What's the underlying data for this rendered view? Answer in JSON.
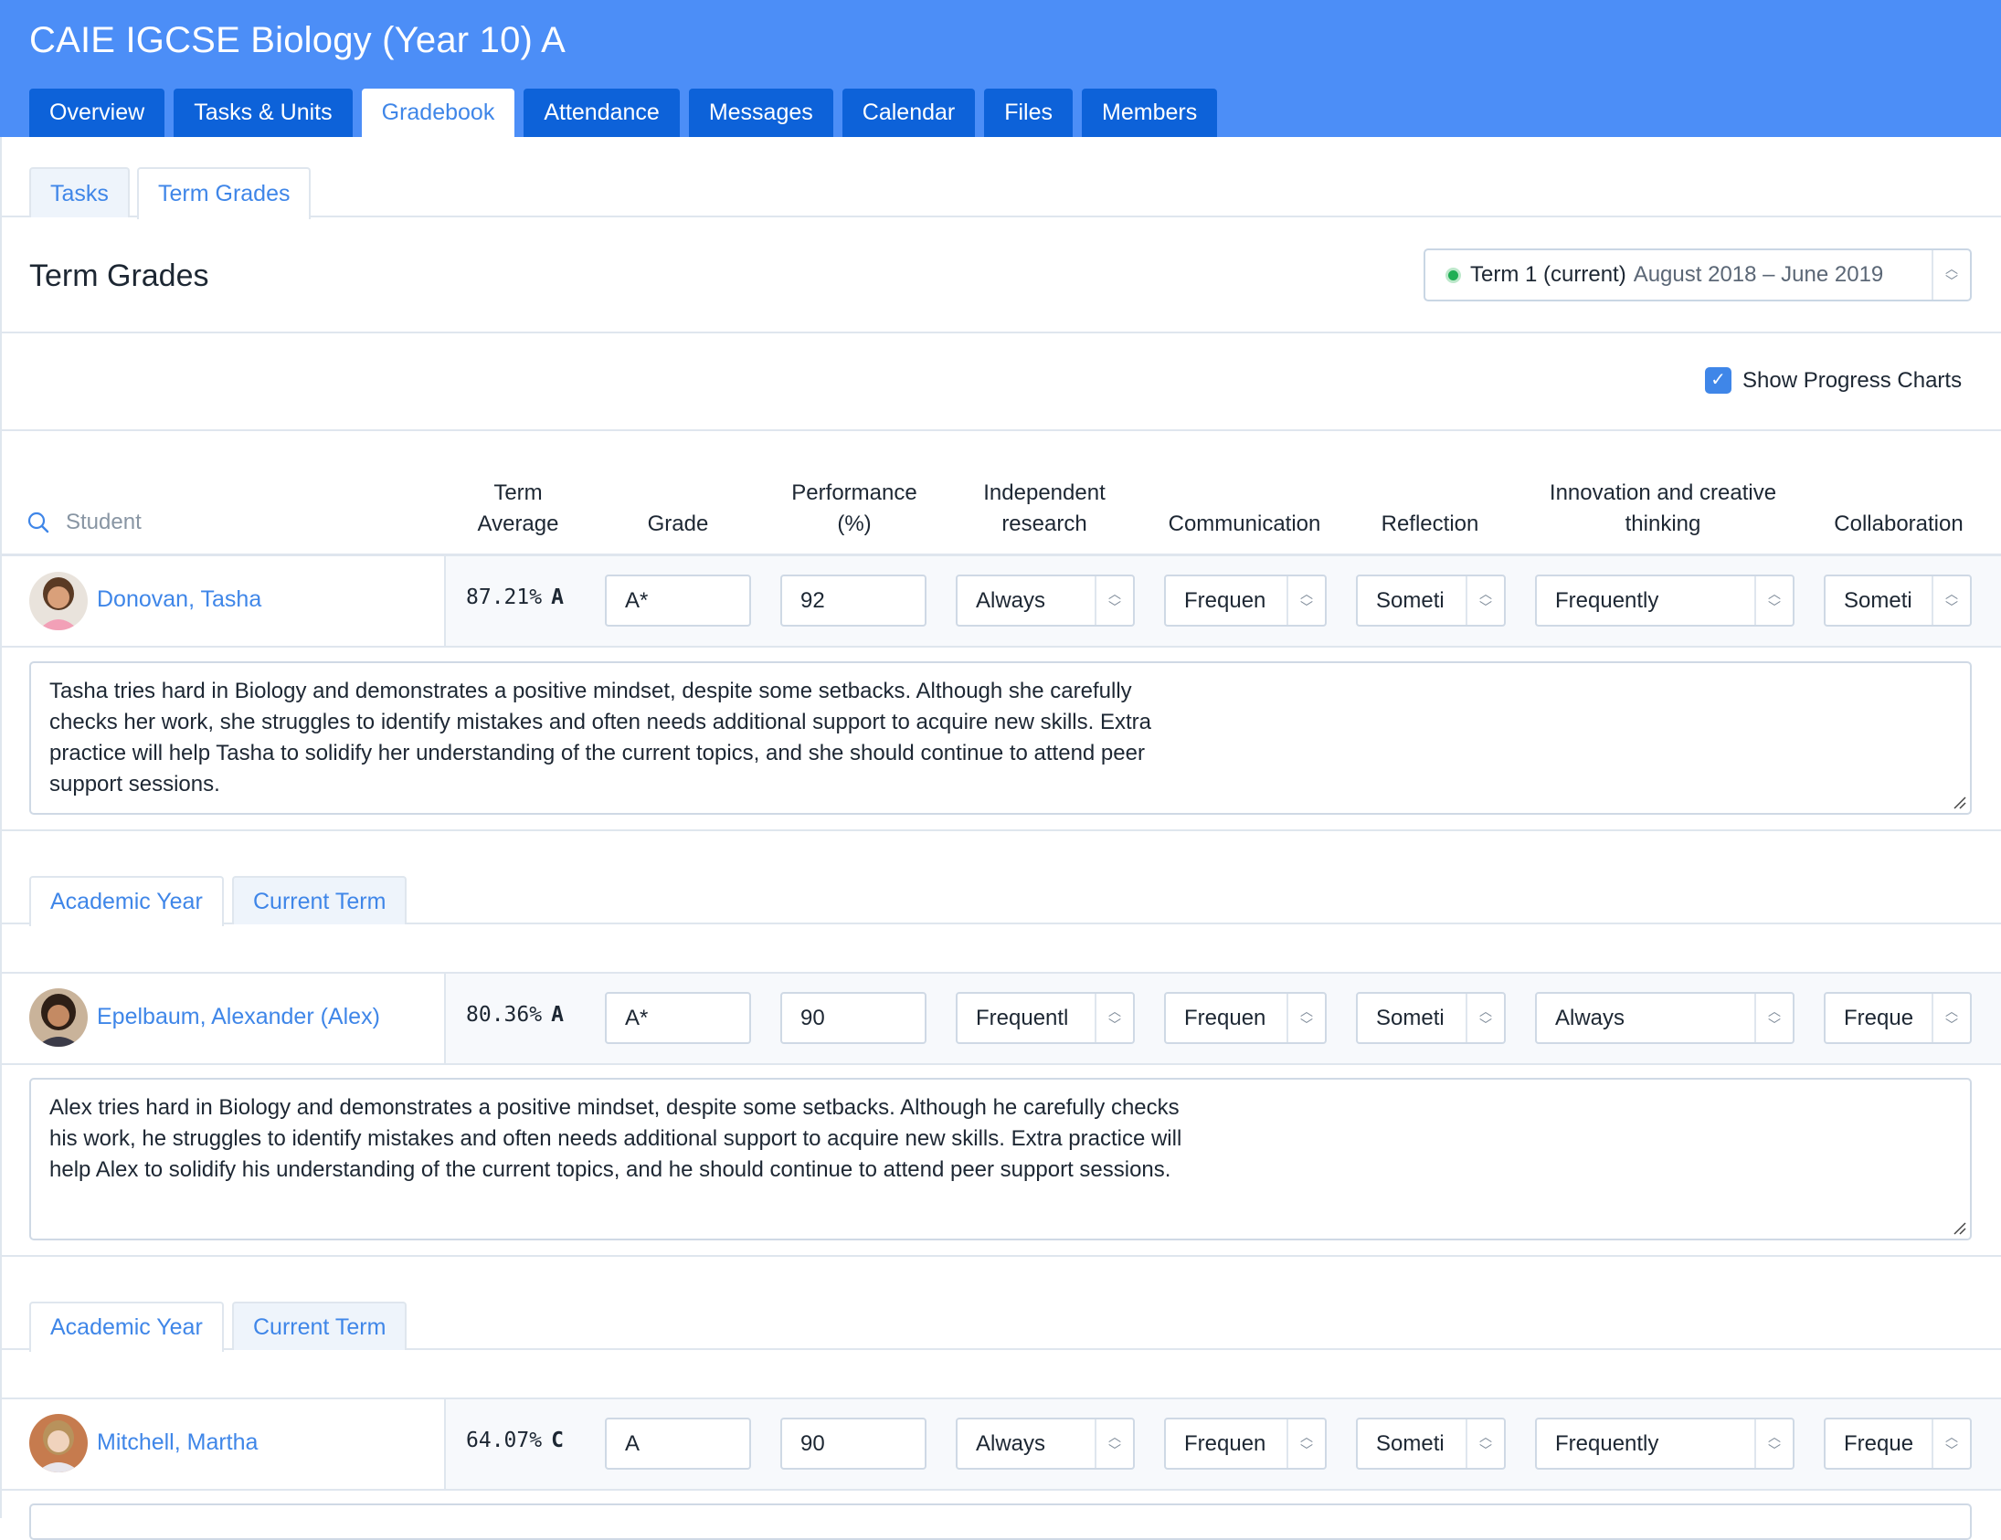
{
  "header": {
    "course_title": "CAIE IGCSE Biology (Year 10) A",
    "tabs": [
      "Overview",
      "Tasks & Units",
      "Gradebook",
      "Attendance",
      "Messages",
      "Calendar",
      "Files",
      "Members"
    ],
    "active_tab": "Gradebook"
  },
  "subtabs": {
    "tasks": "Tasks",
    "term_grades": "Term Grades",
    "active": "Term Grades"
  },
  "section_title": "Term Grades",
  "term_selector": {
    "label": "Term 1 (current)",
    "dates": "August 2018 – June 2019",
    "status_color": "#1fae54"
  },
  "progress_charts": {
    "label": "Show Progress Charts",
    "checked": true
  },
  "columns": {
    "student_placeholder": "Student",
    "term_average_1": "Term",
    "term_average_2": "Average",
    "grade": "Grade",
    "performance_1": "Performance",
    "performance_2": "(%)",
    "independent_1": "Independent",
    "independent_2": "research",
    "communication": "Communication",
    "reflection": "Reflection",
    "innovation_1": "Innovation and creative",
    "innovation_2": "thinking",
    "collaboration": "Collaboration"
  },
  "chart_tabs": {
    "academic_year": "Academic Year",
    "current_term": "Current Term"
  },
  "students": [
    {
      "name": "Donovan, Tasha",
      "term_average": "87.21%",
      "term_letter": "A",
      "grade": "A*",
      "performance": "92",
      "independent_research": "Always",
      "communication": "Frequen",
      "reflection": "Someti",
      "innovation": "Frequently",
      "collaboration": "Someti",
      "comment": "Tasha tries hard in Biology and demonstrates a positive mindset, despite some setbacks. Although she carefully checks her work, she struggles to identify mistakes and often needs additional support to acquire new skills. Extra practice will help Tasha to solidify her understanding of the current topics, and she should continue to attend peer support sessions."
    },
    {
      "name": "Epelbaum, Alexander (Alex)",
      "term_average": "80.36%",
      "term_letter": "A",
      "grade": "A*",
      "performance": "90",
      "independent_research": "Frequentl",
      "communication": "Frequen",
      "reflection": "Someti",
      "innovation": "Always",
      "collaboration": "Freque",
      "comment": "Alex tries hard in Biology and demonstrates a positive mindset, despite some setbacks. Although he carefully checks his work, he struggles to identify mistakes and often needs additional support to acquire new skills. Extra practice will help Alex to solidify his understanding of the current topics, and he should continue to attend peer support sessions."
    },
    {
      "name": "Mitchell, Martha",
      "term_average": "64.07%",
      "term_letter": "C",
      "grade": "A",
      "performance": "90",
      "independent_research": "Always",
      "communication": "Frequen",
      "reflection": "Someti",
      "innovation": "Frequently",
      "collaboration": "Freque"
    }
  ]
}
